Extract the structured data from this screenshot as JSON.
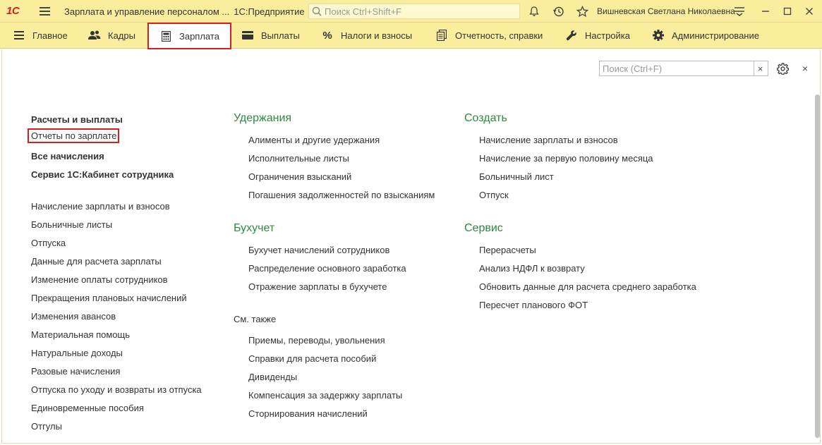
{
  "window": {
    "logo": "1С",
    "title": "Зарплата и управление персоналом ...",
    "platform": "1С:Предприятие",
    "search_placeholder": "Поиск Ctrl+Shift+F",
    "user": "Вишневская Светлана Николаевна"
  },
  "sections": [
    {
      "label": "Главное",
      "icon": "menu-icon"
    },
    {
      "label": "Кадры",
      "icon": "people-icon"
    },
    {
      "label": "Зарплата",
      "icon": "calculator-icon",
      "active": true
    },
    {
      "label": "Выплаты",
      "icon": "wallet-icon"
    },
    {
      "label": "Налоги и взносы",
      "icon": "percent-icon"
    },
    {
      "label": "Отчетность, справки",
      "icon": "documents-icon"
    },
    {
      "label": "Настройка",
      "icon": "wrench-icon"
    },
    {
      "label": "Администрирование",
      "icon": "gear-icon"
    }
  ],
  "panel": {
    "search_placeholder": "Поиск (Ctrl+F)",
    "clear_label": "×",
    "close_label": "×"
  },
  "nav_bold": [
    "Расчеты и выплаты",
    "Отчеты по зарплате",
    "Все начисления",
    "Сервис 1С:Кабинет сотрудника"
  ],
  "nav_list": [
    "Начисление зарплаты и взносов",
    "Больничные листы",
    "Отпуска",
    "Данные для расчета зарплаты",
    "Изменение оплаты сотрудников",
    "Прекращения плановых начислений",
    "Изменения авансов",
    "Материальная помощь",
    "Натуральные доходы",
    "Разовые начисления",
    "Отпуска по уходу и возвраты из отпуска",
    "Единовременные пособия",
    "Отгулы"
  ],
  "groups": {
    "deductions": {
      "title": "Удержания",
      "items": [
        "Алименты и другие удержания",
        "Исполнительные листы",
        "Ограничения взысканий",
        "Погашения задолженностей по взысканиям"
      ]
    },
    "accounting": {
      "title": "Бухучет",
      "items": [
        "Бухучет начислений сотрудников",
        "Распределение основного заработка",
        "Отражение зарплаты в бухучете"
      ]
    },
    "see_also": {
      "title": "См. также",
      "items": [
        "Приемы, переводы, увольнения",
        "Справки для расчета пособий",
        "Дивиденды",
        "Компенсация за задержку зарплаты",
        "Сторнирования начислений"
      ]
    },
    "create": {
      "title": "Создать",
      "items": [
        "Начисление зарплаты и взносов",
        "Начисление за первую половину месяца",
        "Больничный лист",
        "Отпуск"
      ]
    },
    "service": {
      "title": "Сервис",
      "items": [
        "Перерасчеты",
        "Анализ НДФЛ к возврату",
        "Обновить данные для расчета среднего заработка",
        "Пересчет планового ФОТ"
      ]
    }
  },
  "colors": {
    "header_bg": "#fbed9e",
    "group_title": "#2d8a3e",
    "highlight_border": "#d21f1f"
  }
}
